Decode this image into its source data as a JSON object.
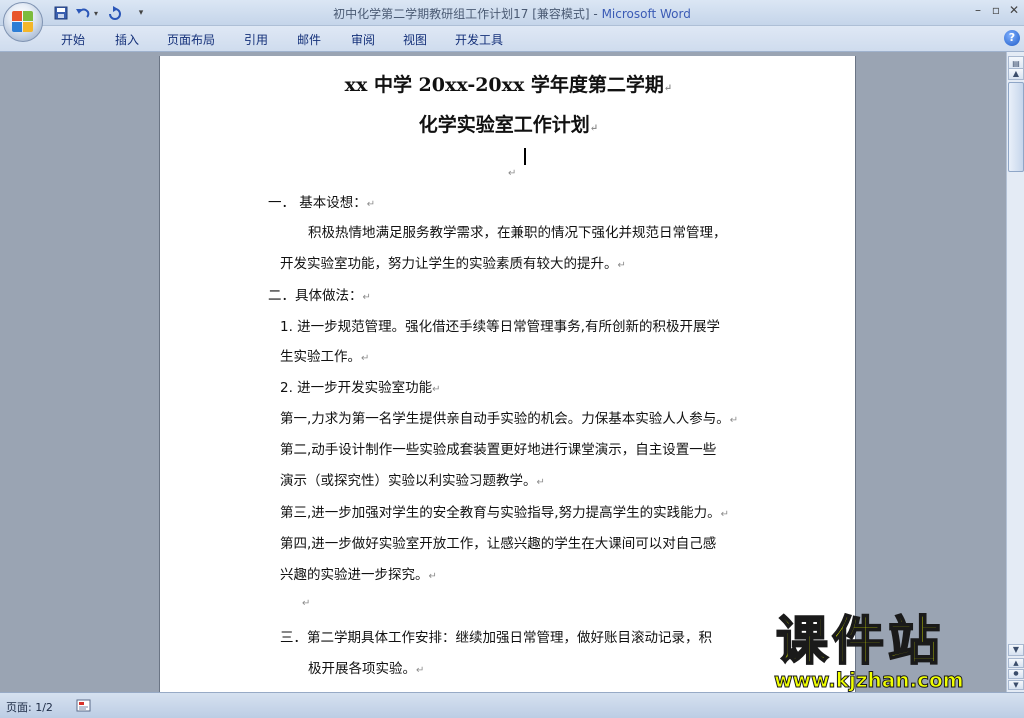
{
  "window": {
    "title": "初中化学第二学期教研组工作计划17 [兼容模式]",
    "app_name": "Microsoft Word",
    "title_separator": " - "
  },
  "ribbon": {
    "tabs": [
      "开始",
      "插入",
      "页面布局",
      "引用",
      "邮件",
      "审阅",
      "视图",
      "开发工具"
    ]
  },
  "icons": {
    "office": "office-button-icon",
    "save": "save-icon",
    "undo": "undo-icon",
    "redo": "redo-icon",
    "help": "help-icon"
  },
  "colors": {
    "accent": "#3b5bb5",
    "watermark": "#f0ff00"
  },
  "document": {
    "title_line1": "xx 中学 20xx-20xx 学年度第二学期",
    "title_line2": "化学实验室工作计划",
    "section1_heading": "一．   基本设想：",
    "section1_body_l1": "积极热情地满足服务教学需求，在兼职的情况下强化并规范日常管理，",
    "section1_body_l2": "开发实验室功能，努力让学生的实验素质有较大的提升。",
    "section2_heading": "二．具体做法：",
    "item1_l1": "1.  进一步规范管理。强化借还手续等日常管理事务,有所创新的积极开展学",
    "item1_l2": "生实验工作。",
    "item2": "2.  进一步开发实验室功能",
    "first": "第一,力求为第一名学生提供亲自动手实验的机会。力保基本实验人人参与。",
    "second_l1": "第二,动手设计制作一些实验成套装置更好地进行课堂演示，自主设置一些",
    "second_l2": "演示（或探究性）实验以利实验习题教学。",
    "third": "第三,进一步加强对学生的安全教育与实验指导,努力提高学生的实践能力。",
    "fourth_l1": "第四,进一步做好实验室开放工作，让感兴趣的学生在大课间可以对自己感",
    "fourth_l2": "兴趣的实验进一步探究。",
    "section3_l1": "三．第二学期具体工作安排：继续加强日常管理，做好账目滚动记录，积",
    "section3_l2": "极开展各项实验。",
    "para_mark": "↵"
  },
  "status": {
    "page": "页面: 1/2"
  },
  "watermark": {
    "title": "课件站",
    "url": "www.kjzhan.com"
  }
}
